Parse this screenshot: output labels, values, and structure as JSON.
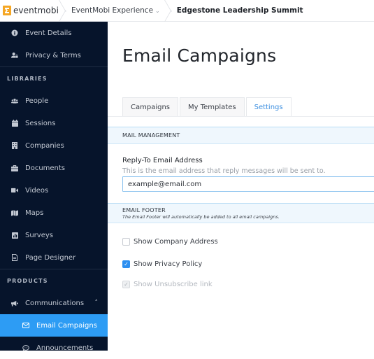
{
  "topbar": {
    "logo_text": "eventmobi",
    "breadcrumbs": [
      {
        "label": "EventMobi Experience",
        "has_dropdown": true
      },
      {
        "label": "Edgestone Leadership Summit"
      }
    ],
    "chevron": "⌄"
  },
  "sidebar": {
    "top_items": [
      {
        "label": "Event Details",
        "icon": "info-icon",
        "glyph": "●"
      },
      {
        "label": "Privacy & Terms",
        "icon": "user-lock-icon",
        "glyph": "👤"
      }
    ],
    "libraries_heading": "LIBRARIES",
    "libraries": [
      {
        "label": "People",
        "icon": "people-icon",
        "glyph": "⚇"
      },
      {
        "label": "Sessions",
        "icon": "calendar-icon",
        "glyph": "▆"
      },
      {
        "label": "Companies",
        "icon": "building-icon",
        "glyph": "▮"
      },
      {
        "label": "Documents",
        "icon": "briefcase-icon",
        "glyph": "▬"
      },
      {
        "label": "Videos",
        "icon": "video-icon",
        "glyph": "■"
      },
      {
        "label": "Maps",
        "icon": "map-icon",
        "glyph": "▥"
      },
      {
        "label": "Surveys",
        "icon": "chart-icon",
        "glyph": "▣"
      },
      {
        "label": "Page Designer",
        "icon": "page-icon",
        "glyph": "▤"
      }
    ],
    "products_heading": "PRODUCTS",
    "products": {
      "label": "Communications",
      "icon": "megaphone-icon",
      "glyph": "◀",
      "caret": "˄",
      "children": [
        {
          "label": "Email Campaigns",
          "icon": "envelope-icon",
          "glyph": "✉",
          "active": true
        },
        {
          "label": "Announcements",
          "icon": "chat-icon",
          "glyph": "◌",
          "active": false
        }
      ]
    }
  },
  "main": {
    "title": "Email Campaigns",
    "tabs": [
      {
        "label": "Campaigns",
        "active": false
      },
      {
        "label": "My Templates",
        "active": false
      },
      {
        "label": "Settings",
        "active": true
      }
    ],
    "mail_management": {
      "title": "MAIL MANAGEMENT",
      "reply_to_label": "Reply-To Email Address",
      "reply_to_help": "This is the email address that reply messages will be sent to.",
      "reply_to_value": "example@email.com"
    },
    "email_footer": {
      "title": "EMAIL FOOTER",
      "subtitle": "The Email Footer will automatically be added to all email campaigns.",
      "options": [
        {
          "label": "Show Company Address",
          "checked": false,
          "disabled": false
        },
        {
          "label": "Show Privacy Policy",
          "checked": true,
          "disabled": false
        },
        {
          "label": "Show Unsubscribe link",
          "checked": true,
          "disabled": true
        }
      ],
      "check_glyph": "✓"
    }
  },
  "colors": {
    "sidebar_bg": "#06142b",
    "active_item": "#2d9cf4",
    "accent_tab": "#3d8fe0",
    "section_bg": "#eff7fd",
    "brand_orange": "#f5a623"
  }
}
